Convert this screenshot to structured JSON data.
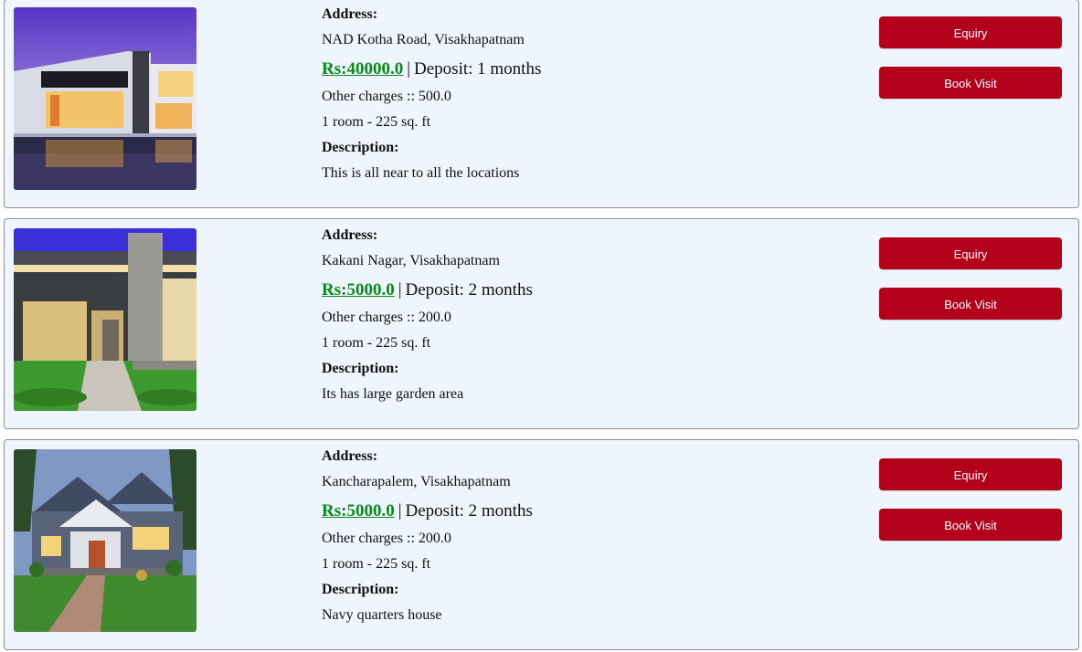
{
  "listings": [
    {
      "address_label": "Address:",
      "address": "NAD Kotha Road, Visakhapatnam",
      "price": "Rs:40000.0",
      "separator": "|",
      "deposit": "Deposit: 1 months",
      "other_charges": "Other charges :: 500.0",
      "room_info": "1 room - 225 sq. ft",
      "description_label": "Description:",
      "description": "This is all near to all the locations",
      "enquiry_label": "Equiry",
      "book_label": "Book Visit",
      "image_icon": "modern-villa-night-photo"
    },
    {
      "address_label": "Address:",
      "address": "Kakani Nagar, Visakhapatnam",
      "price": "Rs:5000.0",
      "separator": "|",
      "deposit": "Deposit: 2 months",
      "other_charges": "Other charges :: 200.0",
      "room_info": "1 room - 225 sq. ft",
      "description_label": "Description:",
      "description": "Its has large garden area",
      "enquiry_label": "Equiry",
      "book_label": "Book Visit",
      "image_icon": "modern-house-garden-photo"
    },
    {
      "address_label": "Address:",
      "address": "Kancharapalem, Visakhapatnam",
      "price": "Rs:5000.0",
      "separator": "|",
      "deposit": "Deposit: 2 months",
      "other_charges": "Other charges :: 200.0",
      "room_info": "1 room - 225 sq. ft",
      "description_label": "Description:",
      "description": "Navy quarters house",
      "enquiry_label": "Equiry",
      "book_label": "Book Visit",
      "image_icon": "craftsman-house-photo"
    }
  ],
  "colors": {
    "card_background": "#eef5fc",
    "card_border": "#8a8f96",
    "button": "#b3001b",
    "price": "#0a8a1e"
  }
}
